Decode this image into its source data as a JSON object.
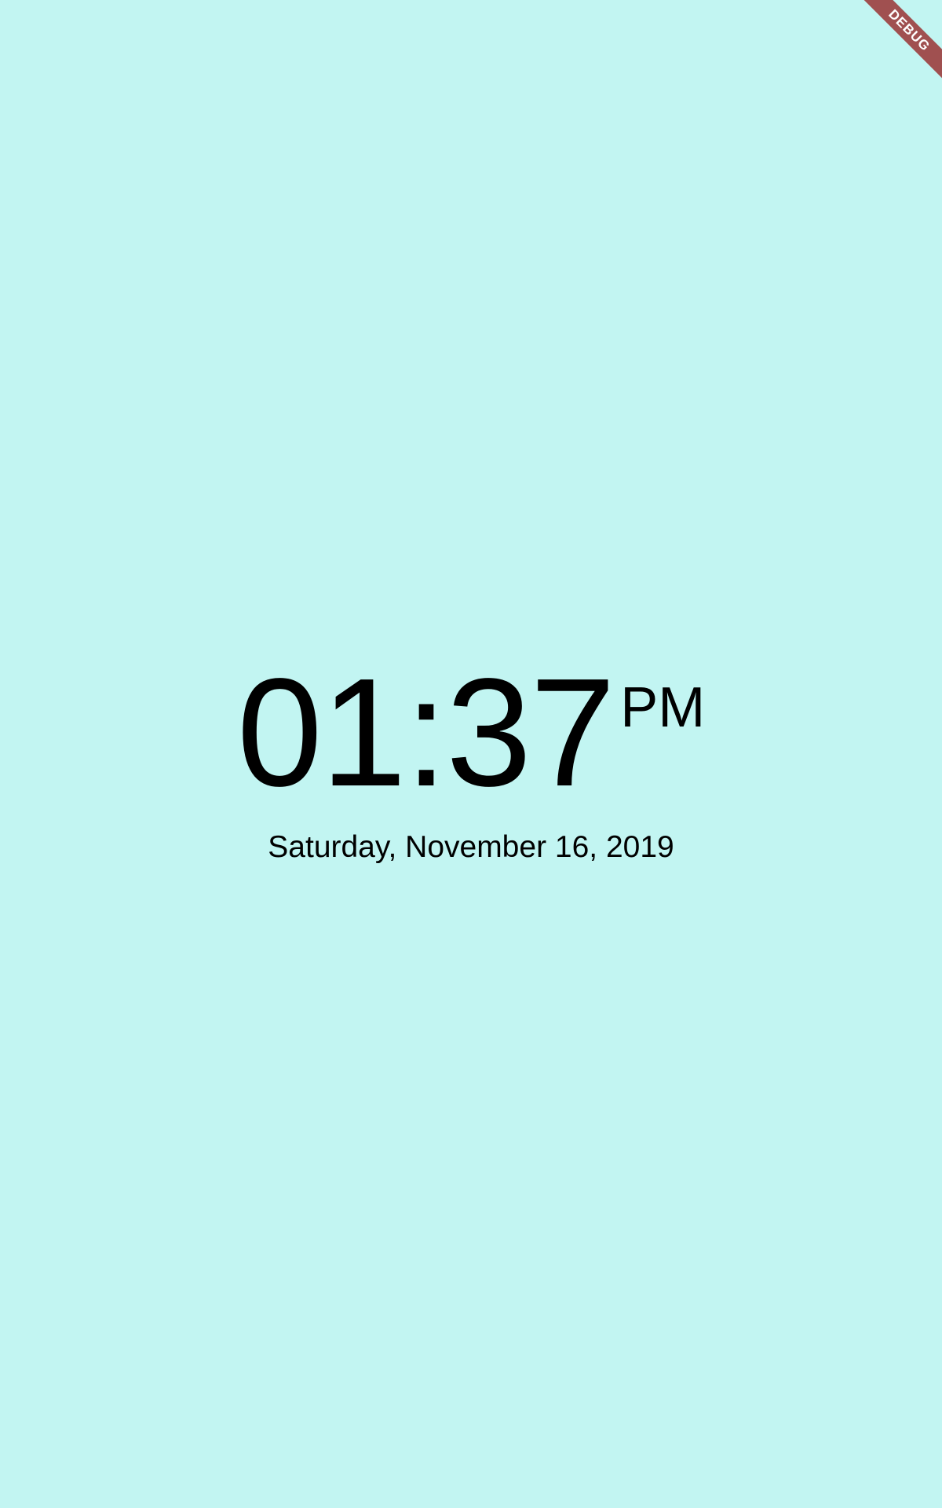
{
  "clock": {
    "time": "01:37",
    "meridiem": "PM",
    "date": "Saturday, November 16, 2019"
  },
  "debug_banner": {
    "label": "DEBUG"
  },
  "colors": {
    "background": "#c2f5f2",
    "text": "#000000",
    "debug_banner": "#a05050"
  }
}
